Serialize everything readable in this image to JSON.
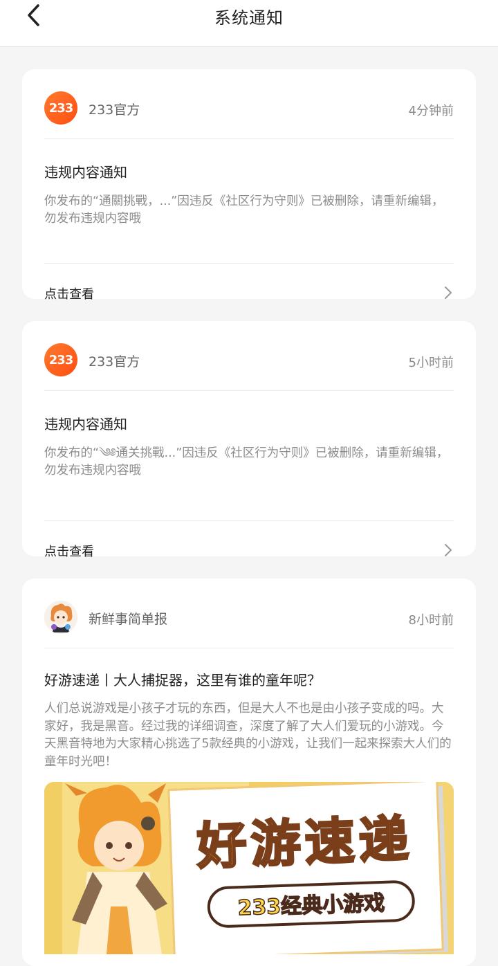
{
  "header": {
    "title": "系统通知"
  },
  "notifications": [
    {
      "sender": "233官方",
      "avatar_text": "233",
      "time": "4分钟前",
      "title": "违规内容通知",
      "body": "你发布的“通關挑戰，...”因违反《社区行为守则》已被删除，请重新编辑，勿发布违规内容哦",
      "action": "点击查看"
    },
    {
      "sender": "233官方",
      "avatar_text": "233",
      "time": "5小时前",
      "title": "违规内容通知",
      "body": "你发布的“༄༅通关挑戰...”因违反《社区行为守则》已被删除，请重新编辑，勿发布违规内容哦",
      "action": "点击查看"
    },
    {
      "sender": "新鲜事简单报",
      "time": "8小时前",
      "title": "好游速递丨大人捕捉器，这里有谁的童年呢？",
      "body": "人们总说游戏是小孩子才玩的东西，但是大人不也是由小孩子变成的吗。大家好，我是黑音。经过我的详细调查，深度了解了大人们爱玩的小游戏。今天黑音特地为大家精心挑选了5款经典的小游戏，让我们一起来探索大人们的童年时光吧！",
      "banner": {
        "headline": "好游速递",
        "subtitle": "233经典小游戏"
      }
    }
  ],
  "colors": {
    "accent": "#ff5a1f",
    "banner_bg": "#f1cf62"
  }
}
